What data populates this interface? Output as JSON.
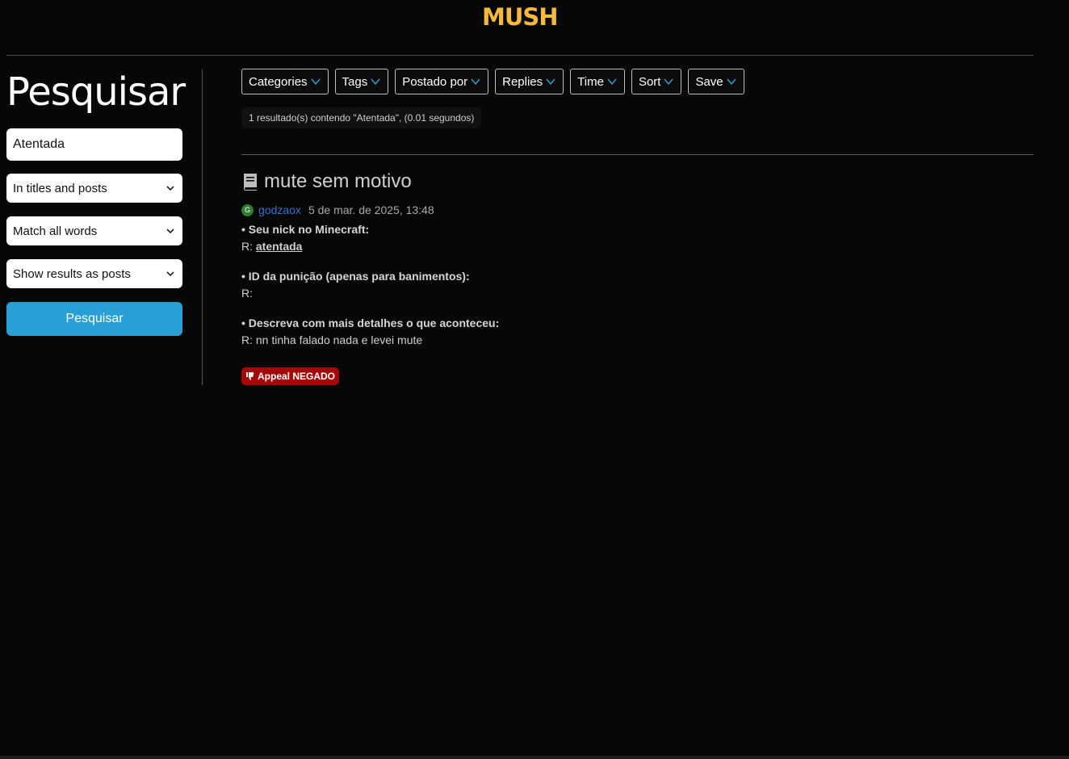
{
  "header": {
    "logo_text": "MUSH"
  },
  "sidebar": {
    "title": "Pesquisar",
    "search_value": "Atentada",
    "selects": [
      "In titles and posts",
      "Match all words",
      "Show results as posts"
    ],
    "submit_label": "Pesquisar"
  },
  "filters": [
    "Categories",
    "Tags",
    "Postado por",
    "Replies",
    "Time",
    "Sort",
    "Save"
  ],
  "results": {
    "count_text": "1 resultado(s) contendo \"Atentada\", (0.01 segundos)"
  },
  "post": {
    "title": "mute sem motivo",
    "avatar_letter": "G",
    "author": "godzaox",
    "date": "5 de mar. de 2025, 13:48",
    "q1": "• Seu nick no Minecraft:",
    "a1_prefix": "R: ",
    "a1_value": "atentada",
    "q2": "• ID da punição (apenas para banimentos):",
    "a2": "R:",
    "q3": "• Descreva com mais detalhes o que aconteceu:",
    "a3": "R: nn tinha falado nada e levei mute",
    "badge_label": "Appeal NEGADO"
  },
  "colors": {
    "background": "#070707",
    "logo": "#f6b93b",
    "accent_button": "#2a9fd6",
    "author_link": "#2e74d4",
    "badge": "#a40808"
  }
}
